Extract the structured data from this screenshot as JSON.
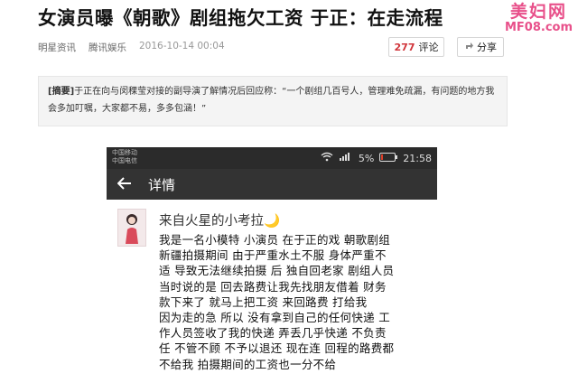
{
  "article": {
    "headline": "女演员曝《朝歌》剧组拖欠工资 于正：在走流程",
    "source": "明星资讯",
    "channel": "腾讯娱乐",
    "time": "2016-10-14 00:04",
    "comment_count": "277",
    "comment_label": "评论",
    "share_label": "分享",
    "summary_tag": "[摘要]",
    "summary_text": "于正在向与闵稞莹对接的副导演了解情况后回应称：“一个剧组几百号人，管理难免疏漏，有问题的地方我会多加叮嘱，大家都不易，多多包涵！”"
  },
  "watermark": {
    "brand": "美妇网",
    "url": "MF08.com"
  },
  "phone": {
    "carrier_line1": "中国移动",
    "carrier_line2": "中国电信",
    "battery": "5%",
    "time": "21:58",
    "nav_title": "详情",
    "author": "来自火星的小考拉",
    "moon_glyph": "🌙",
    "lines": [
      "我是一名小模特 小演员 在于正的戏 朝歌剧组",
      "新疆拍摄期间 由于严重水土不服 身体严重不",
      "适 导致无法继续拍摄 后 独自回老家 剧组人员",
      "当时说的是 回去路费让我先找朋友借着 财务",
      "款下来了 就马上把工资 来回路费 打给我",
      "因为走的急 所以 没有拿到自己的任何快递 工",
      "作人员签收了我的快递 弄丢几乎快递 不负责",
      "任 不管不顾 不予以退还 现在连 回程的路费都",
      "不给我 拍摄期间的工资也一分不给"
    ]
  }
}
